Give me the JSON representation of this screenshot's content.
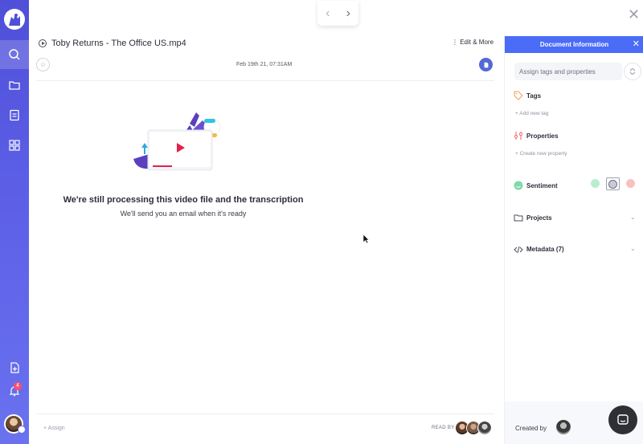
{
  "window": {
    "close_glyph": "✕"
  },
  "pager": {
    "prev_glyph": "‹",
    "next_glyph": "›"
  },
  "header": {
    "file_title": "Toby Returns - The Office US.mp4",
    "edit_more": "⋮ Edit & More",
    "date": "Feb 19th 21, 07:31AM"
  },
  "main": {
    "processing_title": "We're still processing this video file and the transcription",
    "processing_subtitle": "We'll send you an email when it's ready"
  },
  "footer": {
    "assign_label": "+ Assign",
    "read_by_label": "READ BY"
  },
  "sidebar": {
    "notification_count": "4",
    "icons": [
      "logo-icon",
      "search-icon",
      "folder-icon",
      "clipboard-icon",
      "grid-icon",
      "add-document-icon",
      "bell-icon"
    ]
  },
  "panel": {
    "title": "Document Information",
    "close_glyph": "✕",
    "tag_placeholder": "Assign tags and properties",
    "tags_label": "Tags",
    "add_tag_link": "+ Add new tag",
    "properties_label": "Properties",
    "create_property_link": "+ Create new property",
    "sentiment_label": "Sentiment",
    "projects_label": "Projects",
    "metadata_label": "Metadata (7)",
    "created_by_label": "Created by"
  },
  "colors": {
    "sidebar": "#5b5ee6",
    "accent": "#4a6cf7",
    "doc_button": "#5469d4",
    "sentiment_positive": "#7ed9a8",
    "sentiment_neutral": "#6d7080",
    "sentiment_negative": "#f26b6b",
    "chat_button": "#2f3036"
  }
}
